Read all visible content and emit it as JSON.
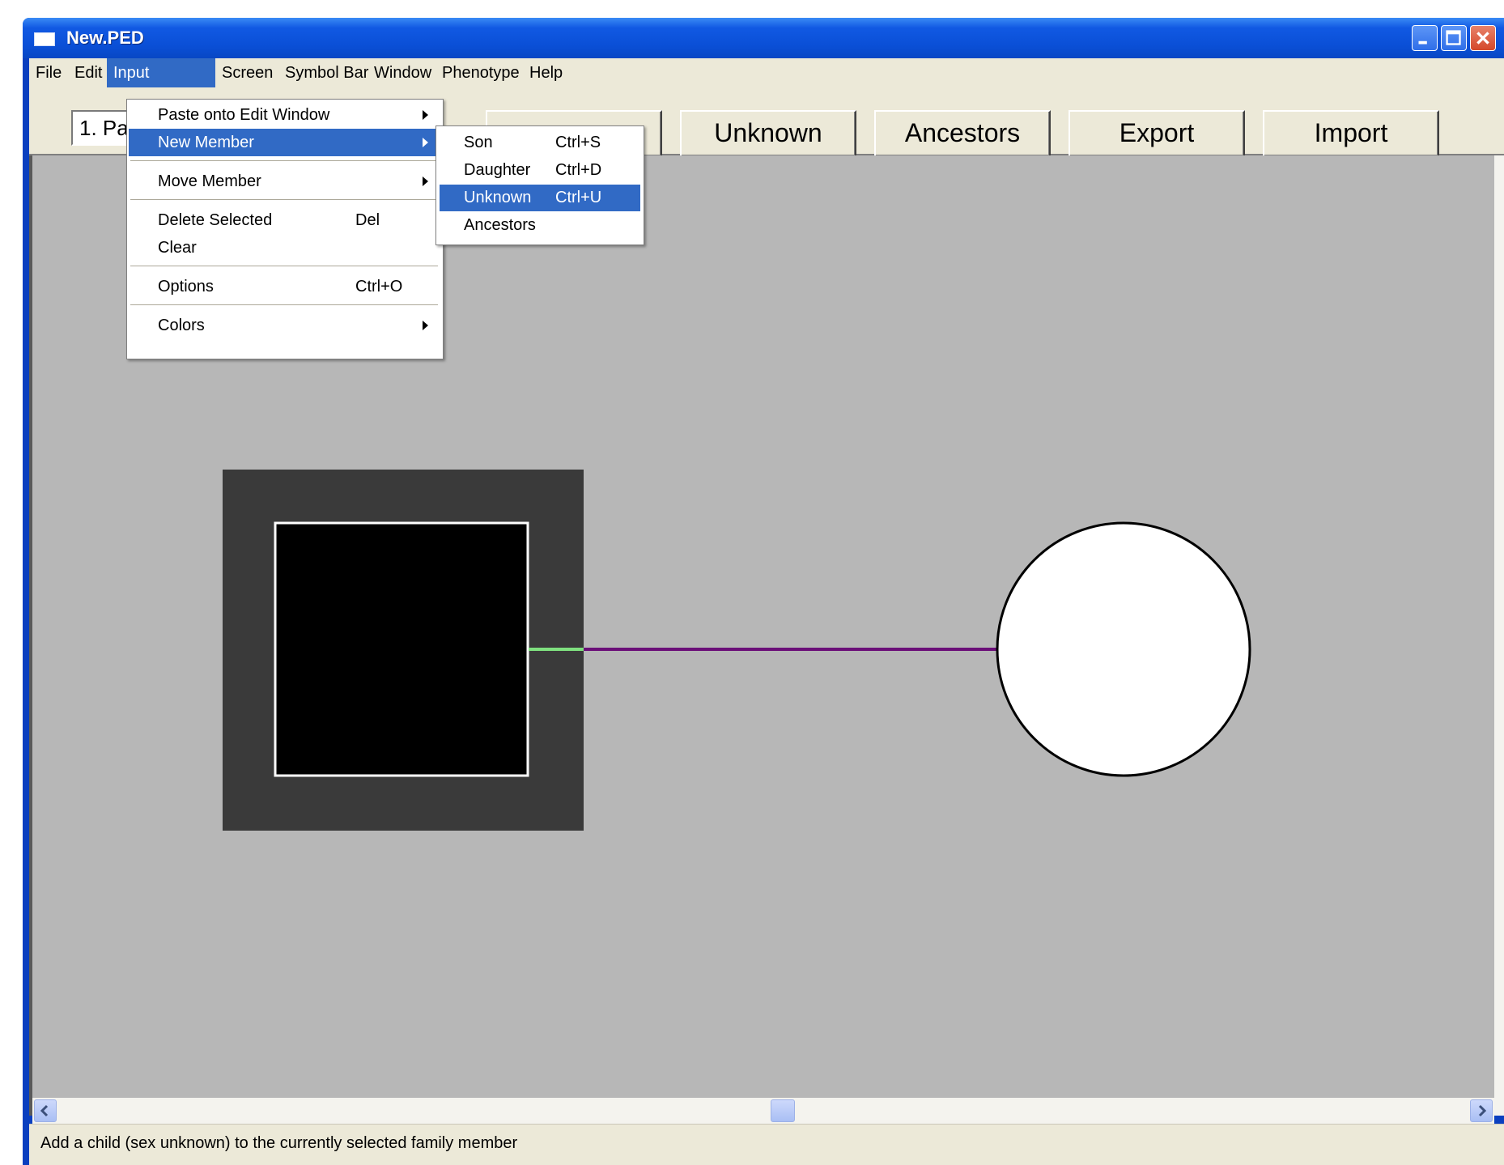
{
  "window": {
    "title": "New.PED",
    "controls": {
      "minimize": "minimize",
      "maximize": "maximize",
      "close": "close"
    }
  },
  "menubar": {
    "items": [
      "File",
      "Edit",
      "Input Window",
      "Screen",
      "Symbol Bar",
      "Window",
      "Phenotype",
      "Help"
    ],
    "active": "Input Window"
  },
  "toolbar": {
    "combo_value": "1. Par",
    "buttons": [
      "Unknown",
      "Ancestors",
      "Export",
      "Import"
    ]
  },
  "input_window_menu": {
    "paste": "Paste onto Edit Window",
    "new_member": "New Member",
    "move_member": "Move Member",
    "delete_selected": "Delete Selected",
    "delete_shortcut": "Del",
    "clear": "Clear",
    "options": "Options",
    "options_shortcut": "Ctrl+O",
    "colors": "Colors"
  },
  "new_member_submenu": [
    {
      "label": "Son",
      "shortcut": "Ctrl+S"
    },
    {
      "label": "Daughter",
      "shortcut": "Ctrl+D"
    },
    {
      "label": "Unknown",
      "shortcut": "Ctrl+U"
    },
    {
      "label": "Ancestors",
      "shortcut": ""
    }
  ],
  "pedigree": {
    "male_fill": "#000000",
    "selection_fill": "#3a3a3a",
    "female_fill": "#ffffff",
    "line_color": "#6b0f78",
    "connector_color": "#7fe07f"
  },
  "status": "Add a child (sex unknown) to the currently selected family member",
  "colors": {
    "menu_highlight": "#316ac5",
    "canvas_bg": "#b7b7b7",
    "chrome": "#ece9d8"
  }
}
